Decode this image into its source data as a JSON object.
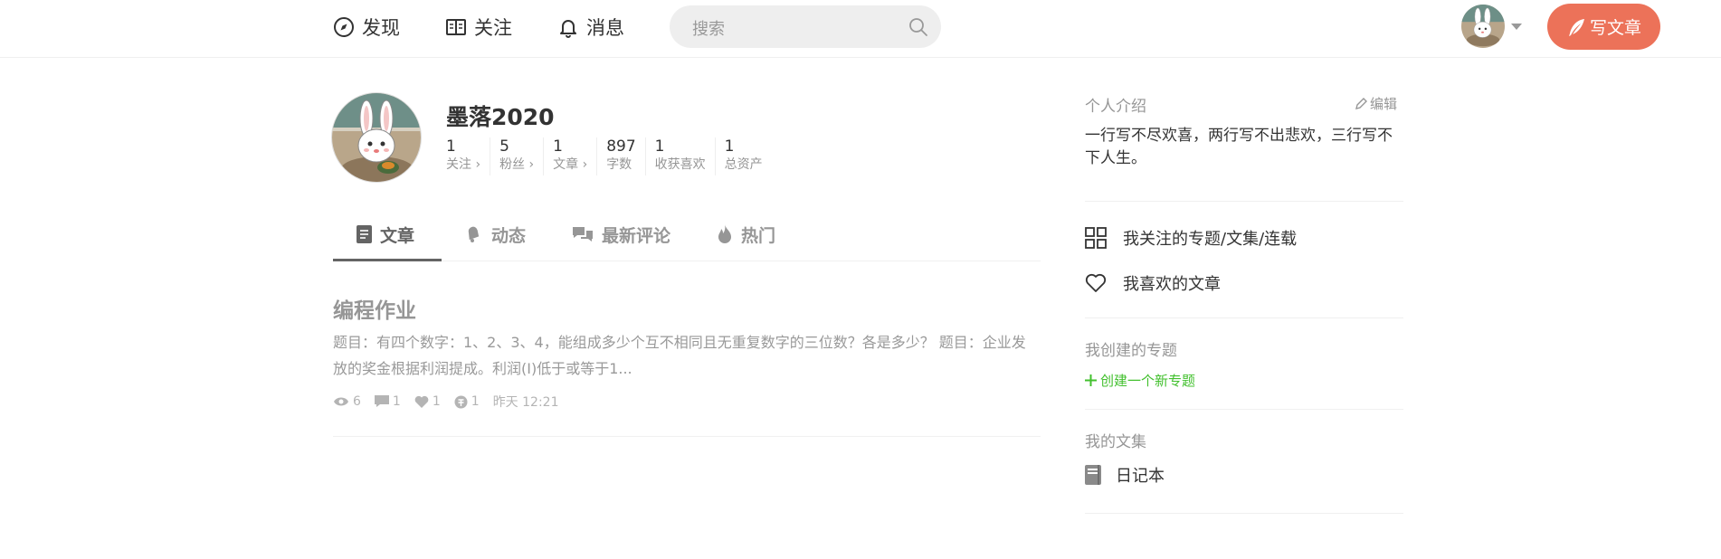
{
  "header": {
    "nav": [
      {
        "label": "发现",
        "icon": "compass-icon"
      },
      {
        "label": "关注",
        "icon": "book-open-icon"
      },
      {
        "label": "消息",
        "icon": "bell-icon"
      }
    ],
    "search_placeholder": "搜索",
    "write_label": "写文章",
    "accent": "#ec7259"
  },
  "profile": {
    "username": "墨落2020",
    "stats": [
      {
        "value": "1",
        "label": "关注 ›"
      },
      {
        "value": "5",
        "label": "粉丝 ›"
      },
      {
        "value": "1",
        "label": "文章 ›"
      },
      {
        "value": "897",
        "label": "字数"
      },
      {
        "value": "1",
        "label": "收获喜欢"
      },
      {
        "value": "1",
        "label": "总资产"
      }
    ]
  },
  "tabs": [
    {
      "label": "文章",
      "icon": "document-icon"
    },
    {
      "label": "动态",
      "icon": "bell-icon"
    },
    {
      "label": "最新评论",
      "icon": "comments-icon"
    },
    {
      "label": "热门",
      "icon": "fire-icon"
    }
  ],
  "article": {
    "title": "编程作业",
    "abstract": "题目：有四个数字：1、2、3、4，能组成多少个互不相同且无重复数字的三位数？各是多少？ 题目：企业发放的奖金根据利润提成。利润(I)低于或等于1...",
    "views": "6",
    "comments": "1",
    "likes": "1",
    "rewards": "1",
    "time": "昨天 12:21"
  },
  "sidebar": {
    "intro_title": "个人介绍",
    "edit_label": "编辑",
    "intro_text": "一行写不尽欢喜，两行写不出悲欢，三行写不下人生。",
    "links": [
      {
        "label": "我关注的专题/文集/连载",
        "icon": "grid-icon"
      },
      {
        "label": "我喜欢的文章",
        "icon": "heart-icon"
      }
    ],
    "collections_title": "我创建的专题",
    "create_collection": "创建一个新专题",
    "notebooks_title": "我的文集",
    "notebooks": [
      "日记本"
    ],
    "create_color": "#42c02e"
  }
}
